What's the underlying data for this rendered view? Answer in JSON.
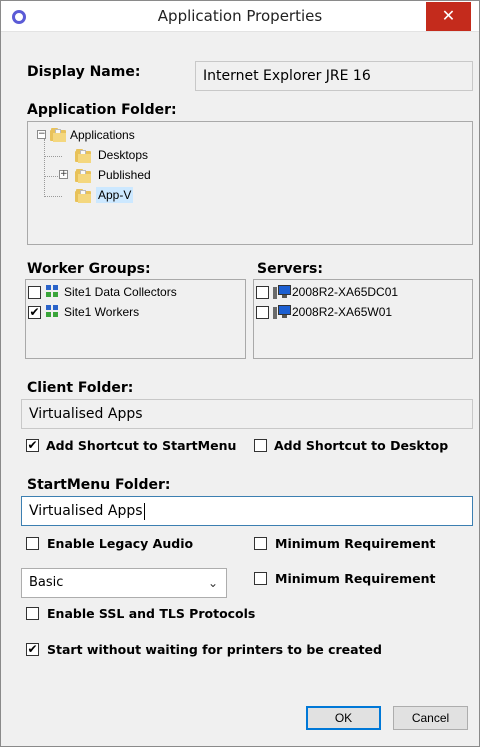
{
  "window": {
    "title": "Application Properties",
    "close_glyph": "✕",
    "icon": "circle-icon"
  },
  "display_name": {
    "label": "Display Name:",
    "value": "Internet Explorer JRE 16"
  },
  "application_folder": {
    "label": "Application Folder:",
    "tree": [
      {
        "label": "Applications",
        "expander": "−"
      },
      {
        "label": "Desktops"
      },
      {
        "label": "Published",
        "expander": "+"
      },
      {
        "label": "App-V",
        "selected": true
      }
    ]
  },
  "worker_groups": {
    "label": "Worker Groups:",
    "items": [
      {
        "label": "Site1 Data Collectors",
        "checked": false
      },
      {
        "label": "Site1 Workers",
        "checked": true
      }
    ]
  },
  "servers": {
    "label": "Servers:",
    "items": [
      {
        "label": "2008R2-XA65DC01",
        "checked": false
      },
      {
        "label": "2008R2-XA65W01",
        "checked": false
      }
    ]
  },
  "client_folder": {
    "label": "Client Folder:",
    "value": "Virtualised Apps"
  },
  "shortcuts": {
    "startmenu": {
      "label": "Add Shortcut to StartMenu",
      "checked": true
    },
    "desktop": {
      "label": "Add Shortcut to Desktop",
      "checked": false
    }
  },
  "startmenu_folder": {
    "label": "StartMenu Folder:",
    "value": "Virtualised Apps"
  },
  "options": {
    "legacy_audio": {
      "label": "Enable Legacy Audio",
      "checked": false
    },
    "min_req_1": {
      "label": "Minimum Requirement",
      "checked": false
    },
    "min_req_2": {
      "label": "Minimum Requirement",
      "checked": false
    },
    "color_select": {
      "value": "Basic",
      "arrow": "⌄"
    },
    "ssl": {
      "label": "Enable SSL and TLS Protocols",
      "checked": false
    },
    "printers": {
      "label": "Start without waiting for printers to be created",
      "checked": true
    }
  },
  "buttons": {
    "ok": "OK",
    "cancel": "Cancel"
  },
  "check_glyph": "✔"
}
